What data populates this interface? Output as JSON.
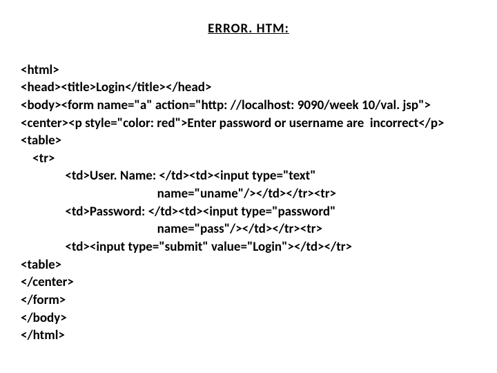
{
  "heading": "ERROR. HTM:",
  "code": {
    "l1": "<html>",
    "l2": "<head><title>Login</title></head>",
    "l3": "<body><form name=\"a\" action=\"http: //localhost: 9090/week 10/val. jsp\">",
    "l4": "<center><p style=\"color: red\">Enter password or username are  incorrect</p>",
    "l5": "<table>",
    "l6": "    <tr>",
    "l7": "               <td>User. Name: </td><td><input type=\"text\"",
    "l8": "                                              name=\"uname\"/></td></tr><tr>",
    "l9": "               <td>Password: </td><td><input type=\"password\"",
    "l10": "                                              name=\"pass\"/></td></tr><tr>",
    "l11": "               <td><input type=\"submit\" value=\"Login\"></td></tr>",
    "l12": "<table>",
    "l13": "</center>",
    "l14": "</form>",
    "l15": "</body>",
    "l16": "</html>"
  }
}
